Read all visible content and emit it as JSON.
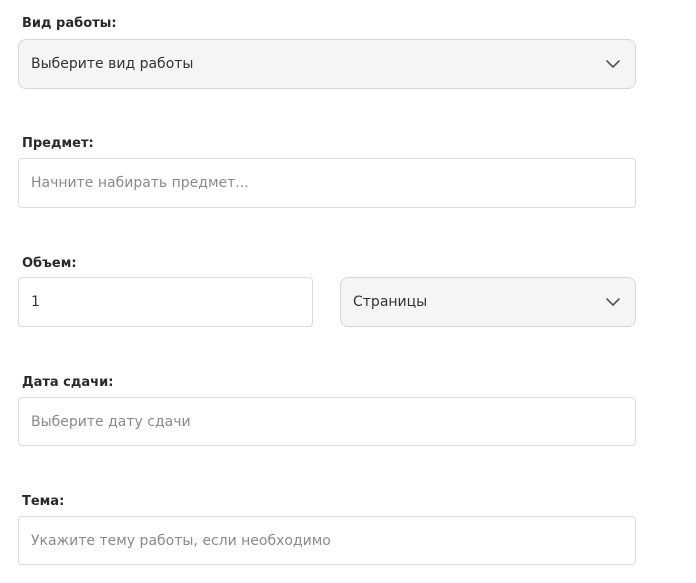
{
  "form": {
    "work_type": {
      "label": "Вид работы:",
      "value": "Выберите вид работы",
      "icon": "chevron-down-icon"
    },
    "subject": {
      "label": "Предмет:",
      "placeholder": "Начните набирать предмет..."
    },
    "volume": {
      "label": "Объем:",
      "value": "1",
      "unit": "Страницы",
      "unit_icon": "chevron-down-icon"
    },
    "deadline": {
      "label": "Дата сдачи:",
      "placeholder": "Выберите дату сдачи"
    },
    "topic": {
      "label": "Тема:",
      "placeholder": "Укажите тему работы, если необходимо"
    }
  },
  "colors": {
    "label": "#2a2a2a",
    "placeholder": "#8a8a8a",
    "field_border": "#dcdcdc",
    "select_bg": "#f5f5f5"
  }
}
